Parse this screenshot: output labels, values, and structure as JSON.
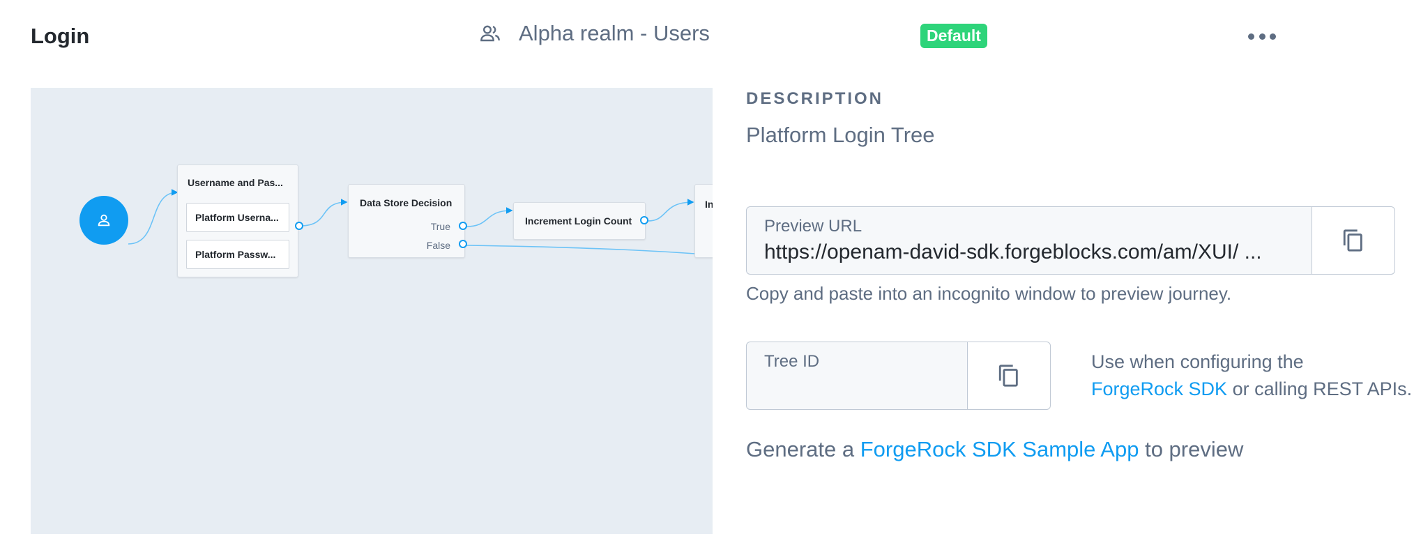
{
  "header": {
    "title": "Login",
    "realm": "Alpha realm - Users",
    "badge": "Default",
    "realm_icon": "users-icon",
    "menu_icon": "more-horizontal-icon"
  },
  "tree": {
    "nodes": {
      "username_password": {
        "title": "Username and Pas...",
        "children": [
          "Platform Userna...",
          "Platform Passw..."
        ]
      },
      "data_store_decision": {
        "title": "Data Store Decision",
        "outcomes": [
          "True",
          "False"
        ]
      },
      "increment_login_count": {
        "title": "Increment Login Count"
      },
      "partial_next": {
        "title": "In"
      }
    },
    "start_icon": "user-icon"
  },
  "details": {
    "description_heading": "DESCRIPTION",
    "description": "Platform Login Tree",
    "preview_url": {
      "label": "Preview URL",
      "value": "https://openam-david-sdk.forgeblocks.com/am/XUI/ ..."
    },
    "preview_help": "Copy and paste into an incognito window to preview journey.",
    "tree_id": {
      "label": "Tree ID",
      "value": ""
    },
    "tree_id_help": {
      "prefix": "Use when configuring the",
      "link": "ForgeRock SDK",
      "suffix": " or calling REST APIs."
    },
    "generate": {
      "prefix": "Generate a ",
      "link": "ForgeRock SDK Sample App",
      "suffix": " to preview"
    },
    "copy_icon": "copy-icon"
  },
  "colors": {
    "accent": "#109cf1",
    "badge": "#2ed47a",
    "canvas": "#e7edf3",
    "text": "#5e6d82",
    "title": "#23282e"
  }
}
